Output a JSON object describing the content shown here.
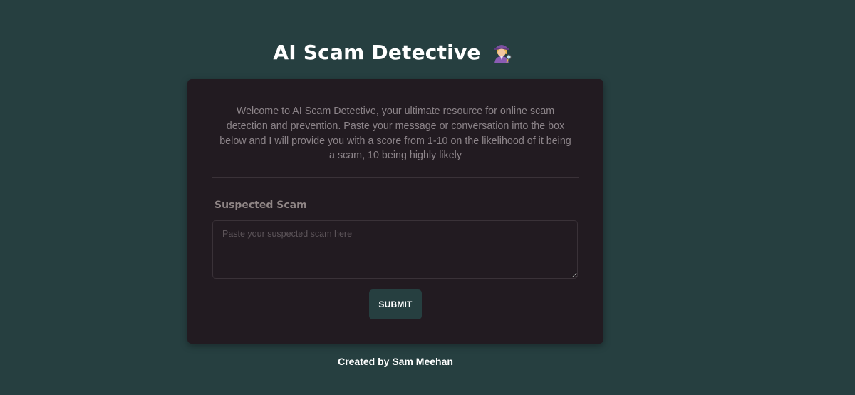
{
  "header": {
    "title": "AI Scam Detective"
  },
  "card": {
    "intro_text": "Welcome to AI Scam Detective, your ultimate resource for online scam detection and prevention. Paste your message or conversation into the box below and I will provide you with a score from 1-10 on the likelihood of it being a scam, 10 being highly likely",
    "field_label": "Suspected Scam",
    "input_placeholder": "Paste your suspected scam here",
    "input_value": "",
    "submit_label": "SUBMIT"
  },
  "footer": {
    "prefix": "Created by",
    "author_link": "Sam Meehan"
  },
  "colors": {
    "page_background": "#263f40",
    "card_background": "#221b21",
    "button_background": "#263f40",
    "text_muted": "#8c8489"
  },
  "icons": {
    "title_icon": "woman-detective-icon"
  }
}
